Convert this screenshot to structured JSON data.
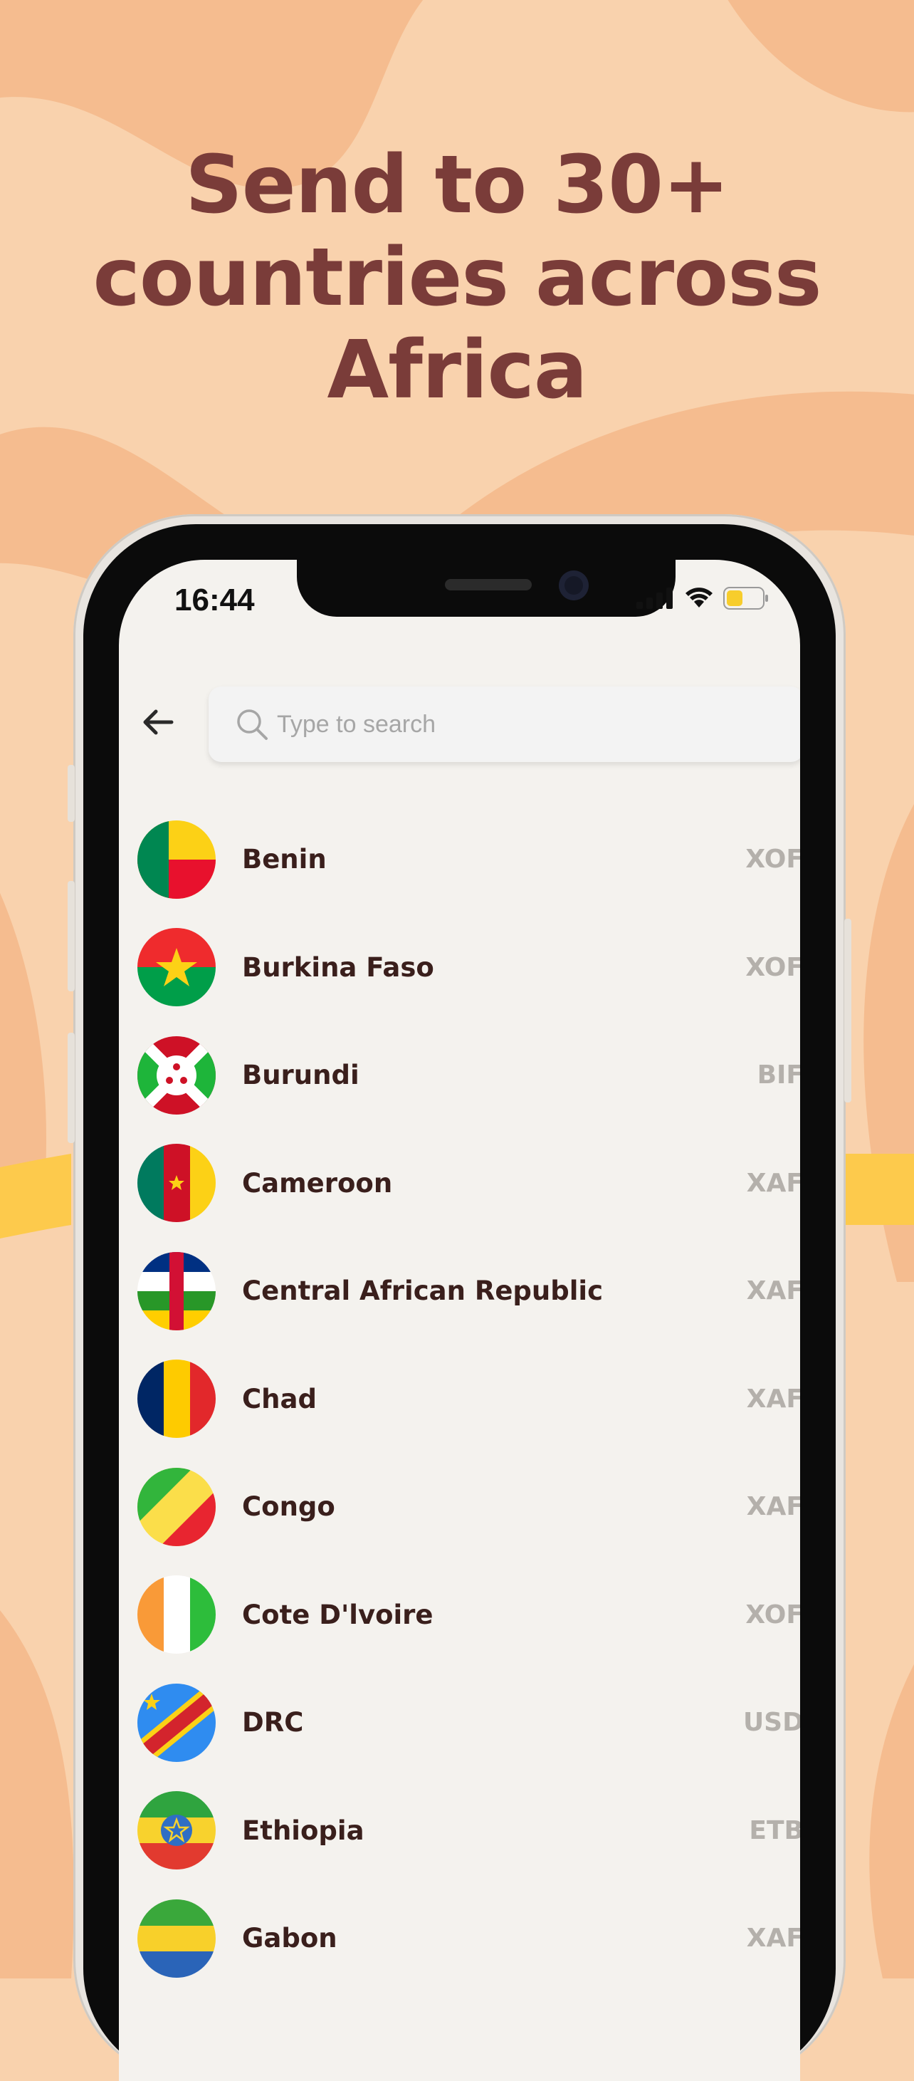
{
  "headline": {
    "line1": "Send to 30+",
    "line2": "countries across",
    "line3": "Africa"
  },
  "status_bar": {
    "time": "16:44",
    "icons": [
      "cellular-signal-icon",
      "wifi-icon",
      "battery-icon"
    ]
  },
  "search": {
    "placeholder": "Type to search",
    "back_icon": "arrow-left-icon",
    "search_icon": "magnifier-icon"
  },
  "countries": [
    {
      "name": "Benin",
      "currency": "XOF"
    },
    {
      "name": "Burkina Faso",
      "currency": "XOF"
    },
    {
      "name": "Burundi",
      "currency": "BIF"
    },
    {
      "name": "Cameroon",
      "currency": "XAF"
    },
    {
      "name": "Central African Republic",
      "currency": "XAF"
    },
    {
      "name": "Chad",
      "currency": "XAF"
    },
    {
      "name": "Congo",
      "currency": "XAF"
    },
    {
      "name": "Cote D'lvoire",
      "currency": "XOF"
    },
    {
      "name": "DRC",
      "currency": "USD"
    },
    {
      "name": "Ethiopia",
      "currency": "ETB"
    },
    {
      "name": "Gabon",
      "currency": "XAF"
    }
  ],
  "colors": {
    "background": "#f9d2ad",
    "headline": "#7a3c39",
    "screen": "#f4f2ee",
    "country_text": "#3a1f1c",
    "currency_text": "#b4b0ab"
  }
}
